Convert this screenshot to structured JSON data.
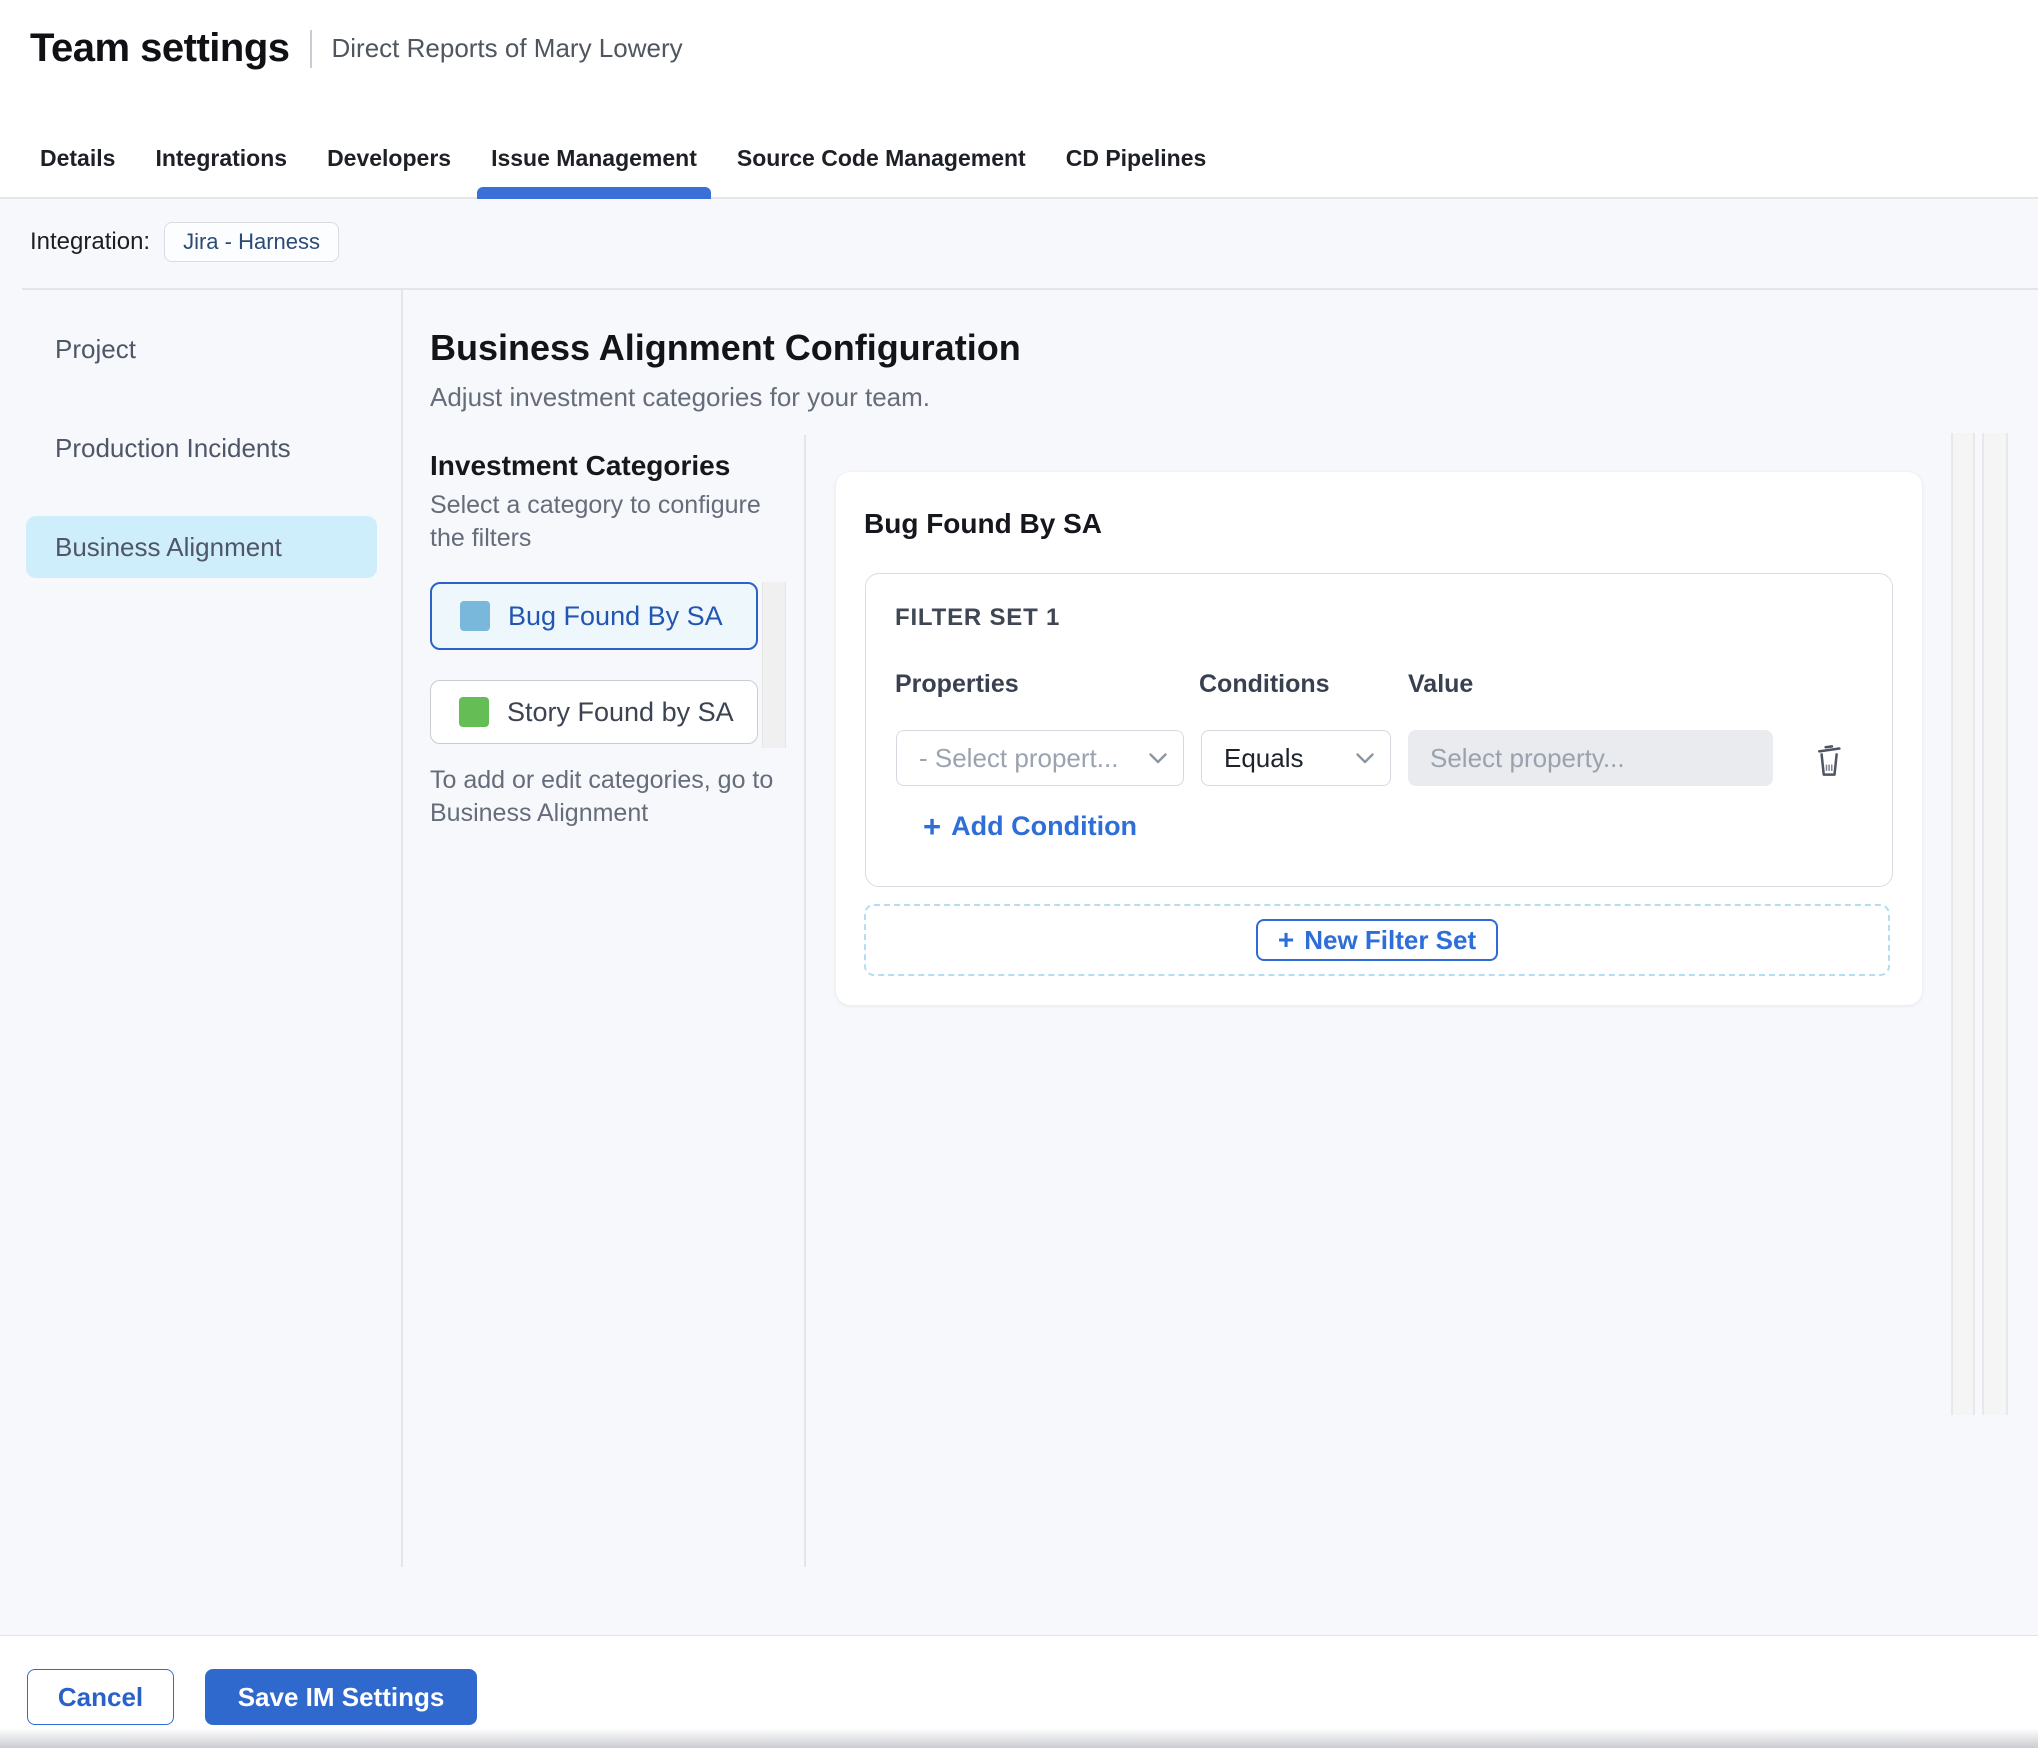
{
  "header": {
    "title": "Team settings",
    "subtitle": "Direct Reports of Mary Lowery"
  },
  "tabs": {
    "active": "Issue Management",
    "items": [
      {
        "label": "Details"
      },
      {
        "label": "Integrations"
      },
      {
        "label": "Developers"
      },
      {
        "label": "Issue Management"
      },
      {
        "label": "Source Code Management"
      },
      {
        "label": "CD Pipelines"
      }
    ]
  },
  "integration": {
    "label": "Integration:",
    "chip": "Jira - Harness"
  },
  "sidebar": {
    "items": [
      {
        "label": "Project",
        "active": false
      },
      {
        "label": "Production Incidents",
        "active": false
      },
      {
        "label": "Business Alignment",
        "active": true
      }
    ]
  },
  "main": {
    "heading": "Business Alignment Configuration",
    "subheading": "Adjust investment categories for your team.",
    "categories": {
      "title": "Investment Categories",
      "description": "Select a category to configure the filters",
      "items": [
        {
          "label": "Bug Found By SA",
          "swatch_color": "#79b7db",
          "selected": true
        },
        {
          "label": "Story Found by SA",
          "swatch_color": "#65bd55",
          "selected": false
        }
      ],
      "note": "To add or edit categories, go to Business Alignment"
    },
    "panel": {
      "title": "Bug Found By SA",
      "filter_set": {
        "title": "FILTER SET 1",
        "columns": [
          "Properties",
          "Conditions",
          "Value"
        ],
        "property_placeholder": "- Select propert...",
        "condition_value": "Equals",
        "value_placeholder": "Select property...",
        "add_condition": "Add Condition"
      },
      "new_filter_set": "New Filter Set"
    }
  },
  "footer": {
    "cancel": "Cancel",
    "save": "Save IM Settings"
  },
  "icons": {
    "plus": "+"
  },
  "colors": {
    "accent_blue": "#2e6ed9",
    "tab_underline": "#3a6fd8",
    "active_nav_bg": "#cfeefb",
    "selected_category_bg": "#eef7fc",
    "selected_category_border": "#2a62c9",
    "swatch_blue": "#79b7db",
    "swatch_green": "#65bd55",
    "dashed_border": "#b5ddf2",
    "content_bg": "#f7f8fb",
    "save_button_bg": "#3069cd"
  }
}
